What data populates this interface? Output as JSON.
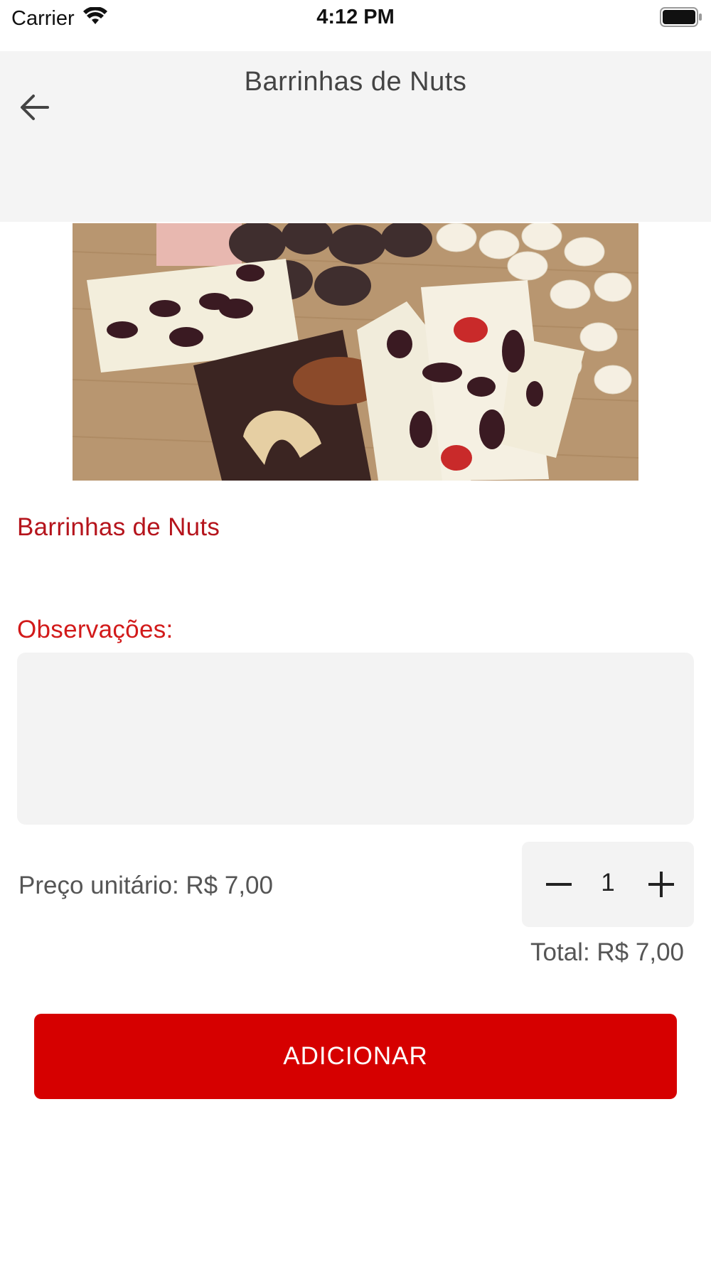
{
  "status_bar": {
    "carrier": "Carrier",
    "time": "4:12 PM",
    "wifi_icon": "wifi-icon",
    "battery_icon": "battery-icon"
  },
  "header": {
    "title": "Barrinhas de Nuts",
    "back_icon": "arrow-left-icon"
  },
  "product": {
    "name": "Barrinhas de Nuts",
    "image_alt": "product-photo"
  },
  "notes": {
    "label": "Observações:",
    "value": "",
    "placeholder": ""
  },
  "pricing": {
    "unit_price": "Preço unitário: R$ 7,00",
    "total": "Total: R$ 7,00"
  },
  "stepper": {
    "quantity": "1",
    "minus_icon": "minus-icon",
    "plus_icon": "plus-icon"
  },
  "actions": {
    "add_label": "ADICIONAR"
  },
  "colors": {
    "accent": "#d60000",
    "title_red": "#b5141c",
    "field_bg": "#f3f3f3",
    "header_bg": "#f4f4f4"
  }
}
